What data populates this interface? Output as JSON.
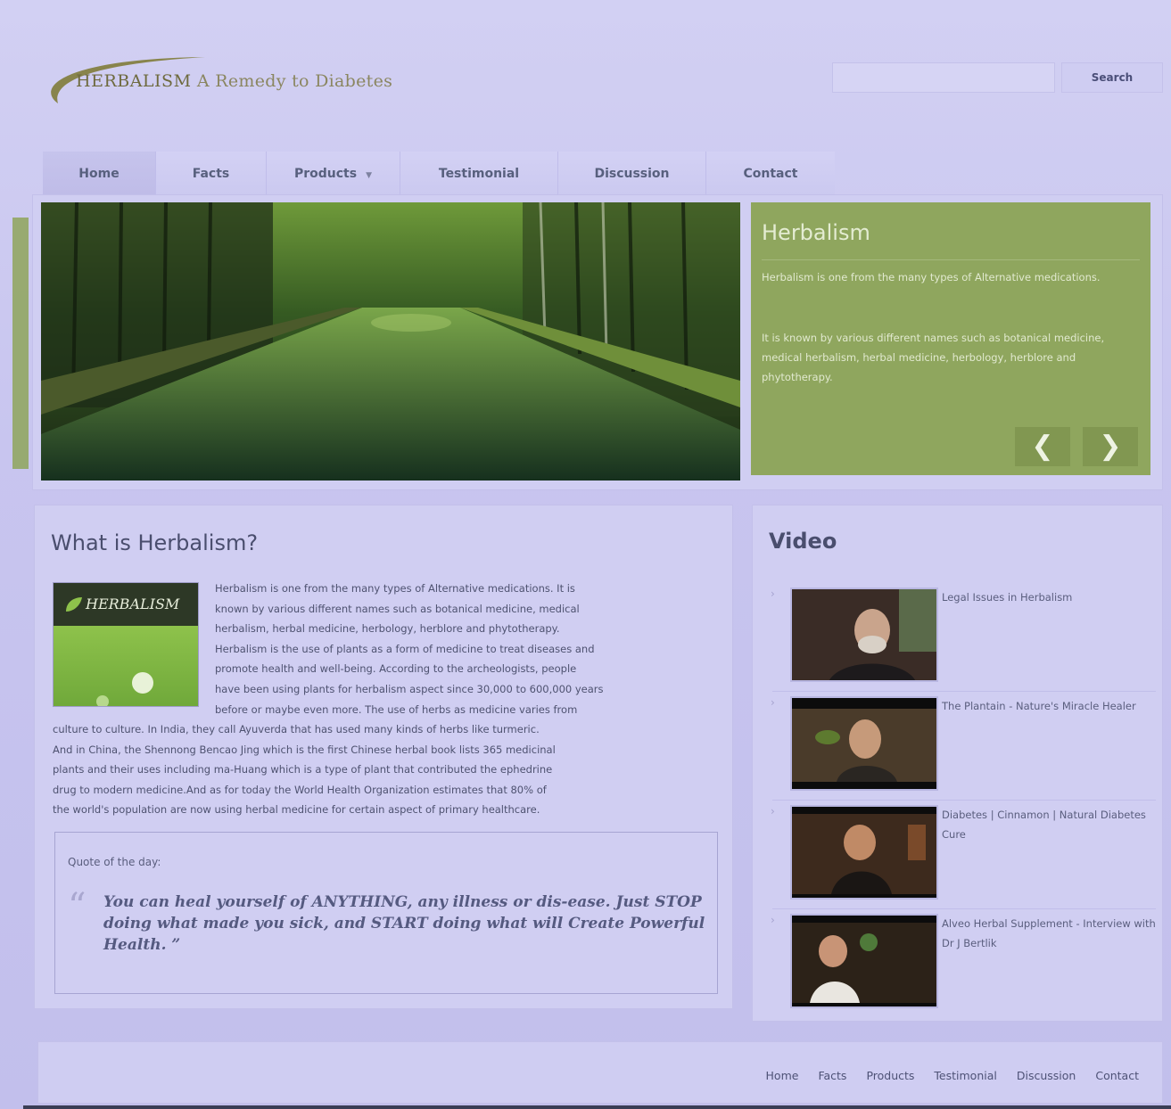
{
  "header": {
    "logo_brand": "HERBALISM",
    "logo_tagline": "A Remedy to Diabetes",
    "search_placeholder": "",
    "search_button": "Search"
  },
  "nav": {
    "items": [
      {
        "label": "Home",
        "active": true
      },
      {
        "label": "Facts"
      },
      {
        "label": "Products",
        "has_dropdown": true
      },
      {
        "label": "Testimonial"
      },
      {
        "label": "Discussion"
      },
      {
        "label": "Contact"
      }
    ]
  },
  "slider": {
    "title": "Herbalism",
    "paragraph_1": "Herbalism is one from the many types of Alternative medications.",
    "paragraph_2": "It is known by various different names such as botanical medicine, medical herbalism, herbal medicine, herbology, herblore and phytotherapy.",
    "prev_icon": "chevron-left-icon",
    "next_icon": "chevron-right-icon",
    "accent_color": "#8fa65e"
  },
  "main": {
    "title": "What is Herbalism?",
    "thumb_label": "HERBALISM",
    "wrapped_lines": [
      "Herbalism is one from the many types of Alternative medications. It is",
      "known by various different names such as botanical medicine, medical",
      "herbalism, herbal medicine, herbology, herblore and phytotherapy.",
      "Herbalism is the use of plants as a form of medicine to treat diseases and",
      "promote health and well-being. According to the archeologists, people",
      "have been using plants for herbalism aspect since 30,000 to 600,000 years",
      "before or maybe even more. The use of herbs as medicine varies from"
    ],
    "full_lines": [
      "culture to culture. In India, they call Ayuverda that has used many kinds of herbs like turmeric.",
      "And in China, the Shennong Bencao Jing which is the first Chinese herbal book lists 365 medicinal",
      "plants and their uses including ma-Huang which is a type of plant that contributed the ephedrine",
      "drug to modern medicine.And as for today the World Health Organization estimates that 80% of",
      "the world's population are now using herbal medicine for certain aspect of primary healthcare."
    ],
    "quote_label": "Quote of the day:",
    "quote_mark": "“",
    "quote_text": "You can heal yourself of ANYTHING, any illness or dis-ease. Just STOP doing what made you sick, and START doing what will Create Powerful Health. ”"
  },
  "videos": {
    "heading": "Video",
    "items": [
      {
        "title": "Legal Issues in Herbalism"
      },
      {
        "title": "The Plantain - Nature's Miracle Healer"
      },
      {
        "title": "Diabetes | Cinnamon | Natural Diabetes Cure"
      },
      {
        "title": "Alveo Herbal Supplement - Interview with Dr J Bertlik"
      }
    ]
  },
  "footer": {
    "links": [
      "Home",
      "Facts",
      "Products",
      "Testimonial",
      "Discussion",
      "Contact"
    ]
  }
}
